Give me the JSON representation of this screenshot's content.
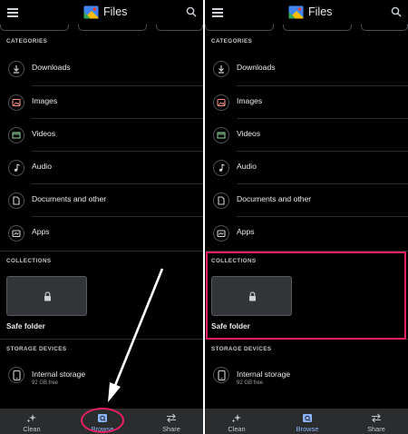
{
  "app": {
    "title": "Files"
  },
  "sections": {
    "categories": "CATEGORIES",
    "collections": "COLLECTIONS",
    "storage": "STORAGE DEVICES"
  },
  "categories": [
    {
      "label": "Downloads",
      "icon": "download-icon"
    },
    {
      "label": "Images",
      "icon": "image-icon"
    },
    {
      "label": "Videos",
      "icon": "video-icon"
    },
    {
      "label": "Audio",
      "icon": "music-note-icon"
    },
    {
      "label": "Documents and other",
      "icon": "document-icon"
    },
    {
      "label": "Apps",
      "icon": "apps-icon"
    }
  ],
  "collections": {
    "safe_folder_label": "Safe folder",
    "icon": "lock-icon"
  },
  "storage": {
    "name": "Internal storage",
    "free": "92 GB free",
    "icon": "phone-icon"
  },
  "nav": {
    "clean": "Clean",
    "browse": "Browse",
    "share": "Share",
    "active": "browse"
  },
  "colors": {
    "background": "#000000",
    "accent": "#8ab4f8",
    "highlight": "#e91e63",
    "card": "#323437",
    "nav_bar": "#2b2c2e"
  }
}
